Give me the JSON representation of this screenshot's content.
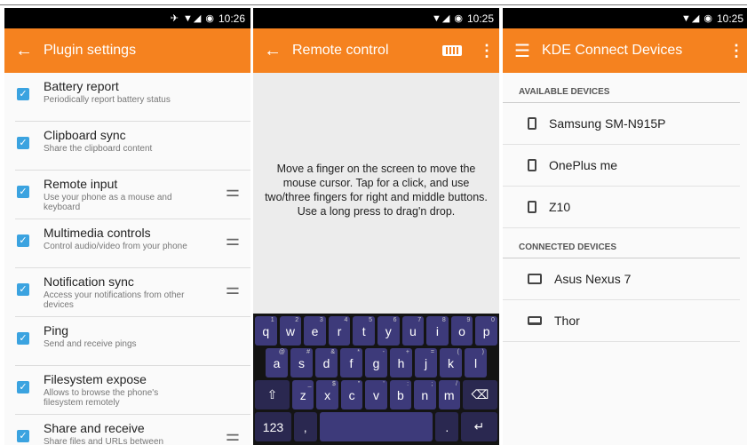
{
  "plugin": {
    "time": "10:26",
    "title": "Plugin settings",
    "items": [
      {
        "title": "Battery report",
        "desc": "Periodically report battery status",
        "settings": false
      },
      {
        "title": "Clipboard sync",
        "desc": "Share the clipboard content",
        "settings": false
      },
      {
        "title": "Remote input",
        "desc": "Use your phone as a mouse and keyboard",
        "settings": true
      },
      {
        "title": "Multimedia controls",
        "desc": "Control audio/video from your phone",
        "settings": true
      },
      {
        "title": "Notification sync",
        "desc": "Access your notifications from other devices",
        "settings": true
      },
      {
        "title": "Ping",
        "desc": "Send and receive pings",
        "settings": false
      },
      {
        "title": "Filesystem expose",
        "desc": "Allows to browse the phone's filesystem remotely",
        "settings": false
      },
      {
        "title": "Share and receive",
        "desc": "Share files and URLs between devices",
        "settings": true
      }
    ]
  },
  "remote": {
    "time": "10:25",
    "title": "Remote control",
    "message": "Move a finger on the screen to move the mouse cursor. Tap for a click, and use two/three fingers for right and middle buttons. Use a long press to drag'n drop.",
    "keyboard": {
      "row1": [
        [
          "q",
          "1"
        ],
        [
          "w",
          "2"
        ],
        [
          "e",
          "3"
        ],
        [
          "r",
          "4"
        ],
        [
          "t",
          "5"
        ],
        [
          "y",
          "6"
        ],
        [
          "u",
          "7"
        ],
        [
          "i",
          "8"
        ],
        [
          "o",
          "9"
        ],
        [
          "p",
          "0"
        ]
      ],
      "row2": [
        [
          "a",
          "@"
        ],
        [
          "s",
          "#"
        ],
        [
          "d",
          "&"
        ],
        [
          "f",
          "*"
        ],
        [
          "g",
          "-"
        ],
        [
          "h",
          "+"
        ],
        [
          "j",
          "="
        ],
        [
          "k",
          "("
        ],
        [
          "l",
          ")"
        ]
      ],
      "row3": [
        [
          "z",
          "_"
        ],
        [
          "x",
          "$"
        ],
        [
          "c",
          "\""
        ],
        [
          "v",
          "'"
        ],
        [
          "b",
          ":"
        ],
        [
          "n",
          ";"
        ],
        [
          "m",
          "/"
        ]
      ],
      "numkey": "123",
      "comma": ",",
      "period": "."
    }
  },
  "devices": {
    "time": "10:25",
    "title": "KDE Connect Devices",
    "available_header": "AVAILABLE DEVICES",
    "available": [
      {
        "name": "Samsung SM-N915P",
        "icon": "phone-icon"
      },
      {
        "name": "OnePlus me",
        "icon": "phone-icon"
      },
      {
        "name": "Z10",
        "icon": "phone-icon"
      }
    ],
    "connected_header": "CONNECTED DEVICES",
    "connected": [
      {
        "name": "Asus Nexus 7",
        "icon": "tablet-icon"
      },
      {
        "name": "Thor",
        "icon": "laptop-icon"
      }
    ]
  }
}
